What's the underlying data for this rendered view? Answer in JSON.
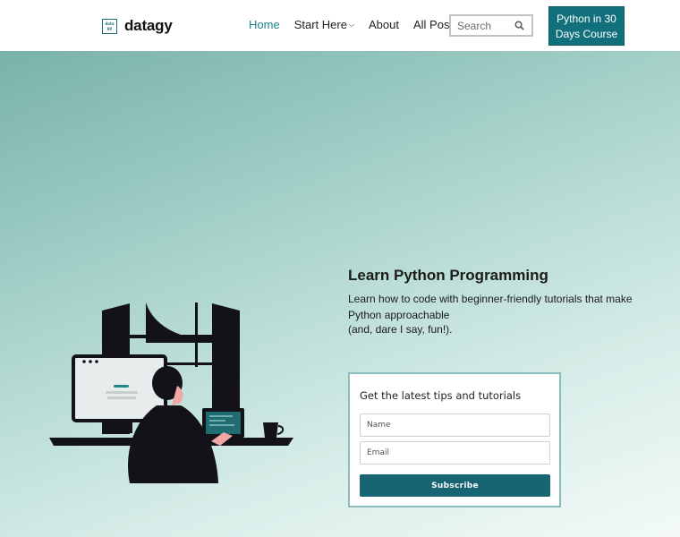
{
  "header": {
    "logo_line1": "data",
    "logo_line2": "gy",
    "brand": "datagy",
    "nav": {
      "home": "Home",
      "start_here": "Start Here",
      "about": "About",
      "all_posts": "All Posts"
    },
    "search_placeholder": "Search",
    "cta_line1": "Python in 30",
    "cta_line2": "Days Course"
  },
  "hero": {
    "title": "Learn Python Programming",
    "description": "Learn how to code with beginner-friendly tutorials that make Python approachable",
    "description2": "(and, dare I say, fun!)."
  },
  "signup": {
    "title": "Get the latest tips and tutorials",
    "name_placeholder": "Name",
    "email_placeholder": "Email",
    "button": "Subscribe"
  },
  "colors": {
    "brand_teal": "#12707c",
    "active_nav": "#1b7f8a",
    "subscribe_bg": "#176473"
  },
  "icons": [
    "logo-icon",
    "chevron-down-icon",
    "search-icon"
  ]
}
